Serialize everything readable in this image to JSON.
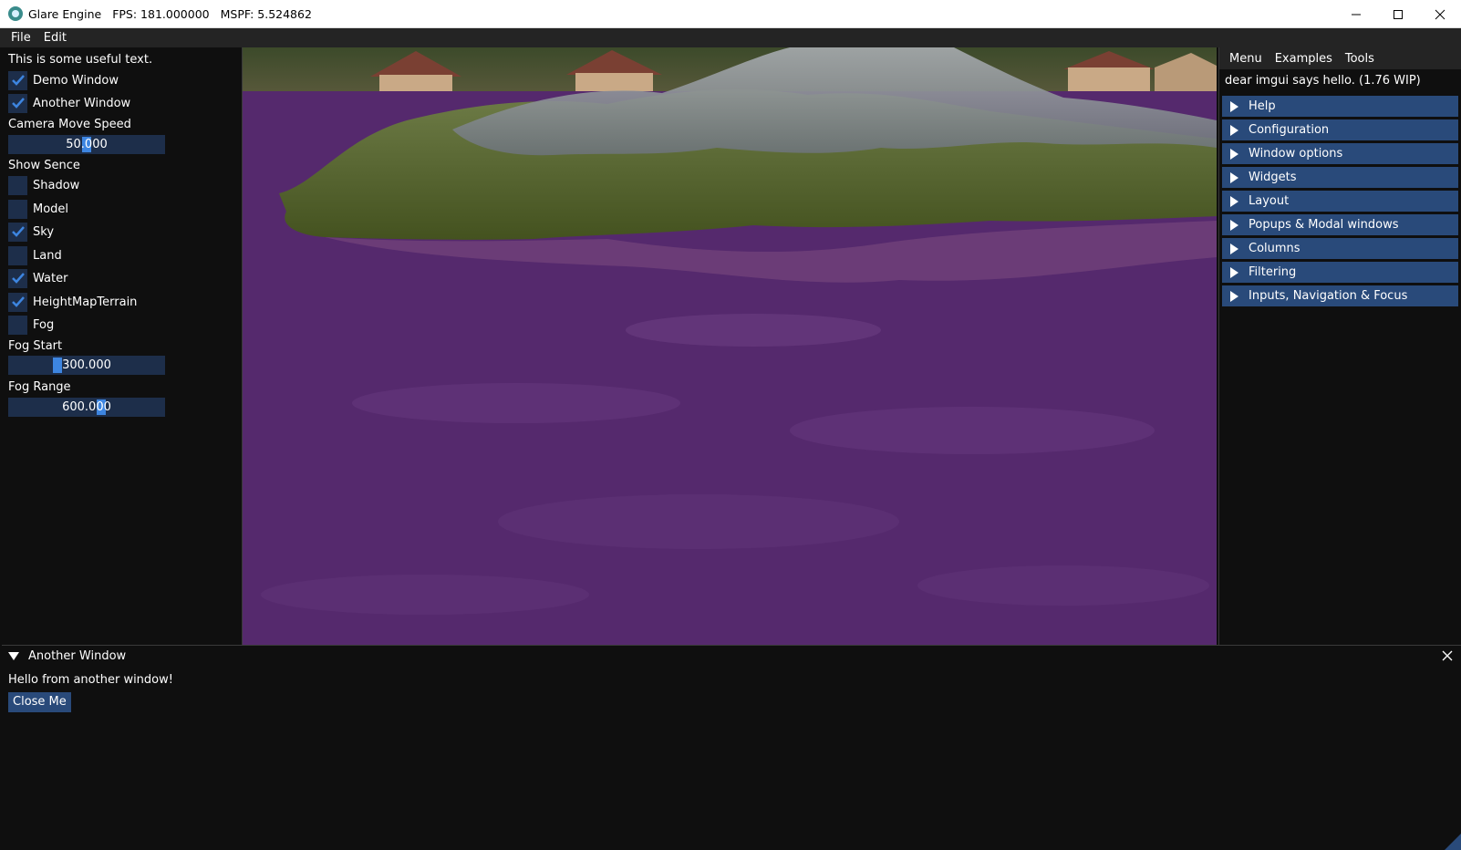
{
  "titlebar": {
    "app_name": "Glare Engine",
    "fps": "FPS: 181.000000",
    "mspf": "MSPF: 5.524862"
  },
  "main_menu": [
    "File",
    "Edit"
  ],
  "left_panel": {
    "useful_text": "This is some useful text.",
    "demo_window_label": "Demo Window",
    "demo_window_checked": true,
    "another_window_label": "Another Window",
    "another_window_checked": true,
    "camera_speed_label": "Camera Move Speed",
    "camera_speed_value": "50.000",
    "show_scene_label": "Show Sence",
    "scene_items": [
      {
        "label": "Shadow",
        "checked": false
      },
      {
        "label": "Model",
        "checked": false
      },
      {
        "label": "Sky",
        "checked": true
      },
      {
        "label": "Land",
        "checked": false
      },
      {
        "label": "Water",
        "checked": true
      },
      {
        "label": "HeightMapTerrain",
        "checked": true
      },
      {
        "label": "Fog",
        "checked": false
      }
    ],
    "fog_start_label": "Fog Start",
    "fog_start_value": "300.000",
    "fog_range_label": "Fog Range",
    "fog_range_value": "600.000"
  },
  "demo_panel": {
    "menu": [
      "Menu",
      "Examples",
      "Tools"
    ],
    "hello": "dear imgui says hello. (1.76 WIP)",
    "sections": [
      "Help",
      "Configuration",
      "Window options",
      "Widgets",
      "Layout",
      "Popups & Modal windows",
      "Columns",
      "Filtering",
      "Inputs, Navigation & Focus"
    ]
  },
  "another_window": {
    "title": "Another Window",
    "text": "Hello from another window!",
    "close_button": "Close Me"
  },
  "colors": {
    "widget_bg": "#1d2e4a",
    "header": "#294a7a",
    "accent": "#3d85e0",
    "water": "#4f2765"
  }
}
